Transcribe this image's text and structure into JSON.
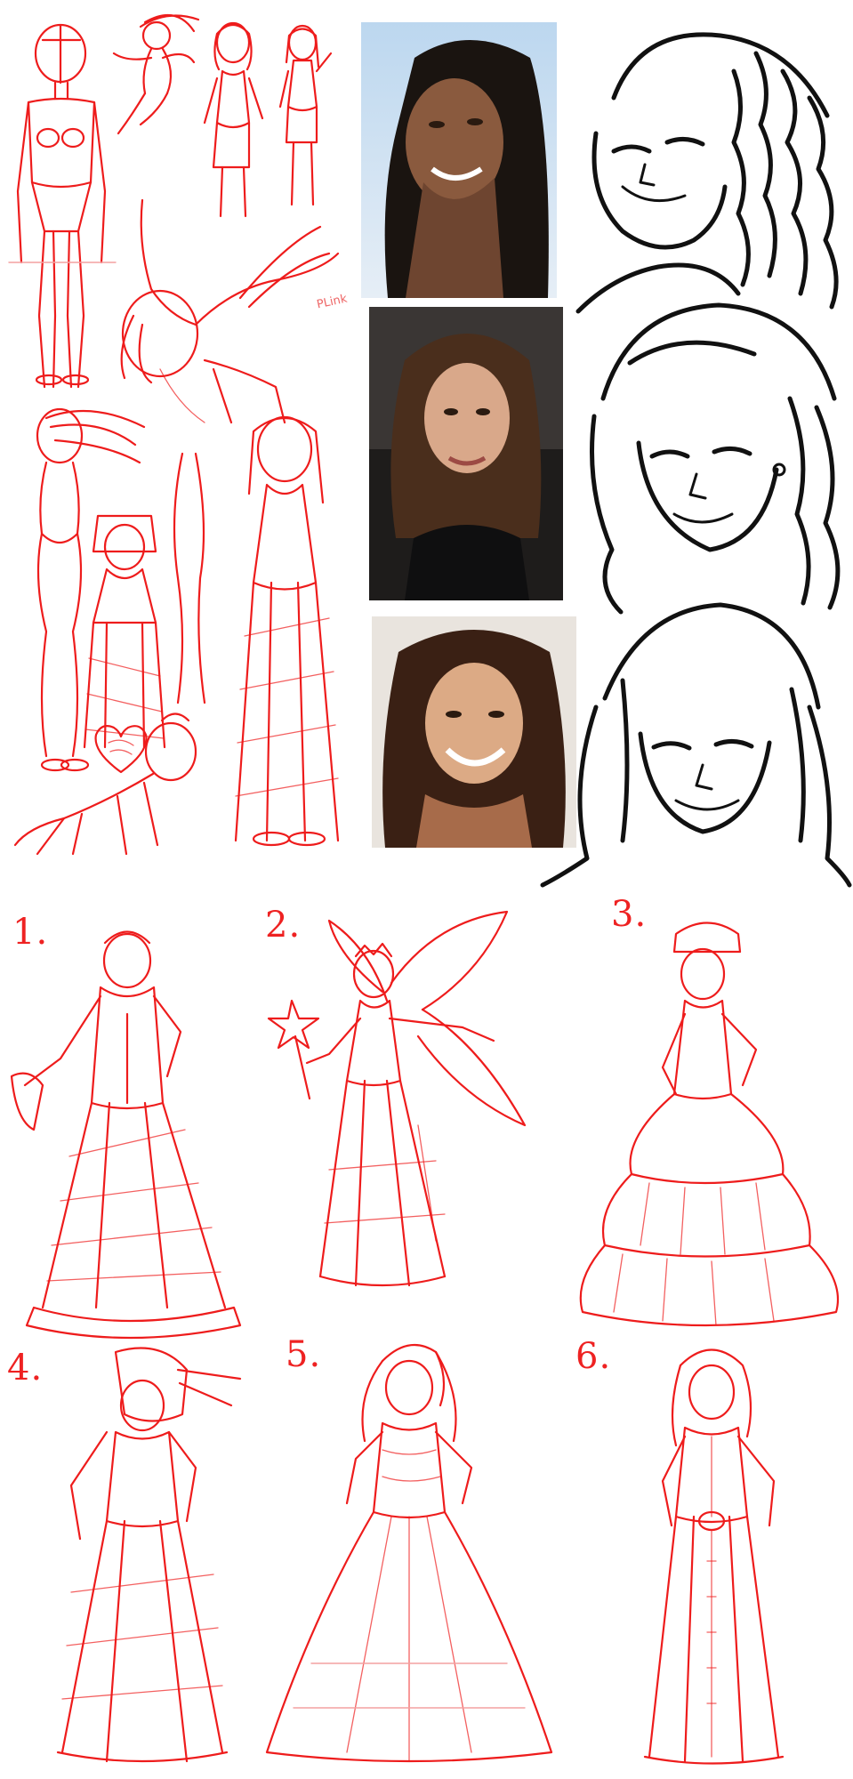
{
  "sketch_numbers": [
    "1.",
    "2.",
    "3.",
    "4.",
    "5.",
    "6."
  ],
  "small_note": "PLink",
  "colors": {
    "sketch_red": "#ee1c1c",
    "ink_black": "#111111",
    "background": "#ffffff"
  },
  "icons": [
    "heart-doodle-icon"
  ],
  "photo_subjects": [
    "smiling-woman-curly-hair",
    "brunette-woman-portrait",
    "smiling-woman-long-hair"
  ]
}
